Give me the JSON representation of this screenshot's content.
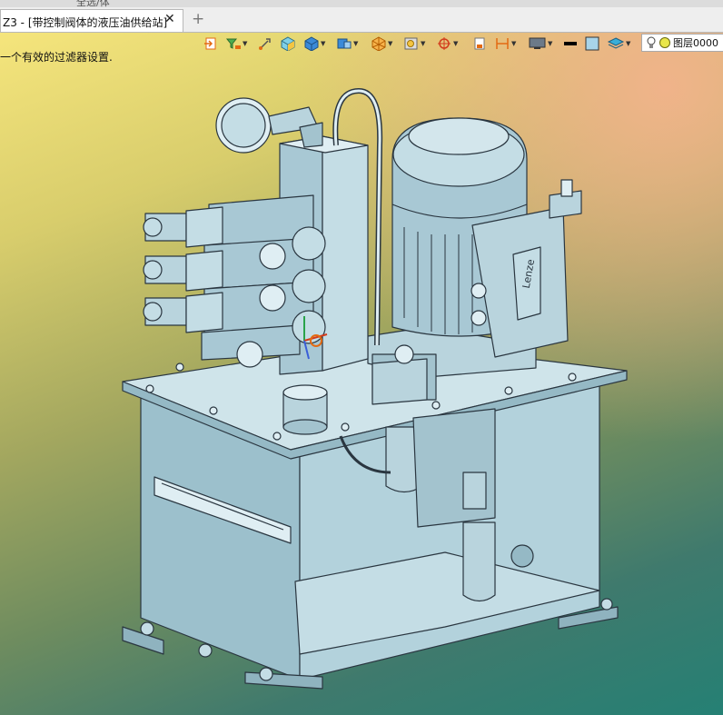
{
  "topstrip": {
    "selection_filter": "全选/体"
  },
  "tab": {
    "title": "Z3 - [带控制阀体的液压油供给站]",
    "close_glyph": "✕",
    "add_glyph": "+"
  },
  "status_message": "一个有效的过滤器设置.",
  "toolbar": {
    "layer_label": "图层0000"
  },
  "model": {
    "motor_brand": "Lenze"
  },
  "colors": {
    "model_fill": "#a8c8d4",
    "model_stroke": "#2a3640",
    "accent_orange": "#e36a12"
  }
}
